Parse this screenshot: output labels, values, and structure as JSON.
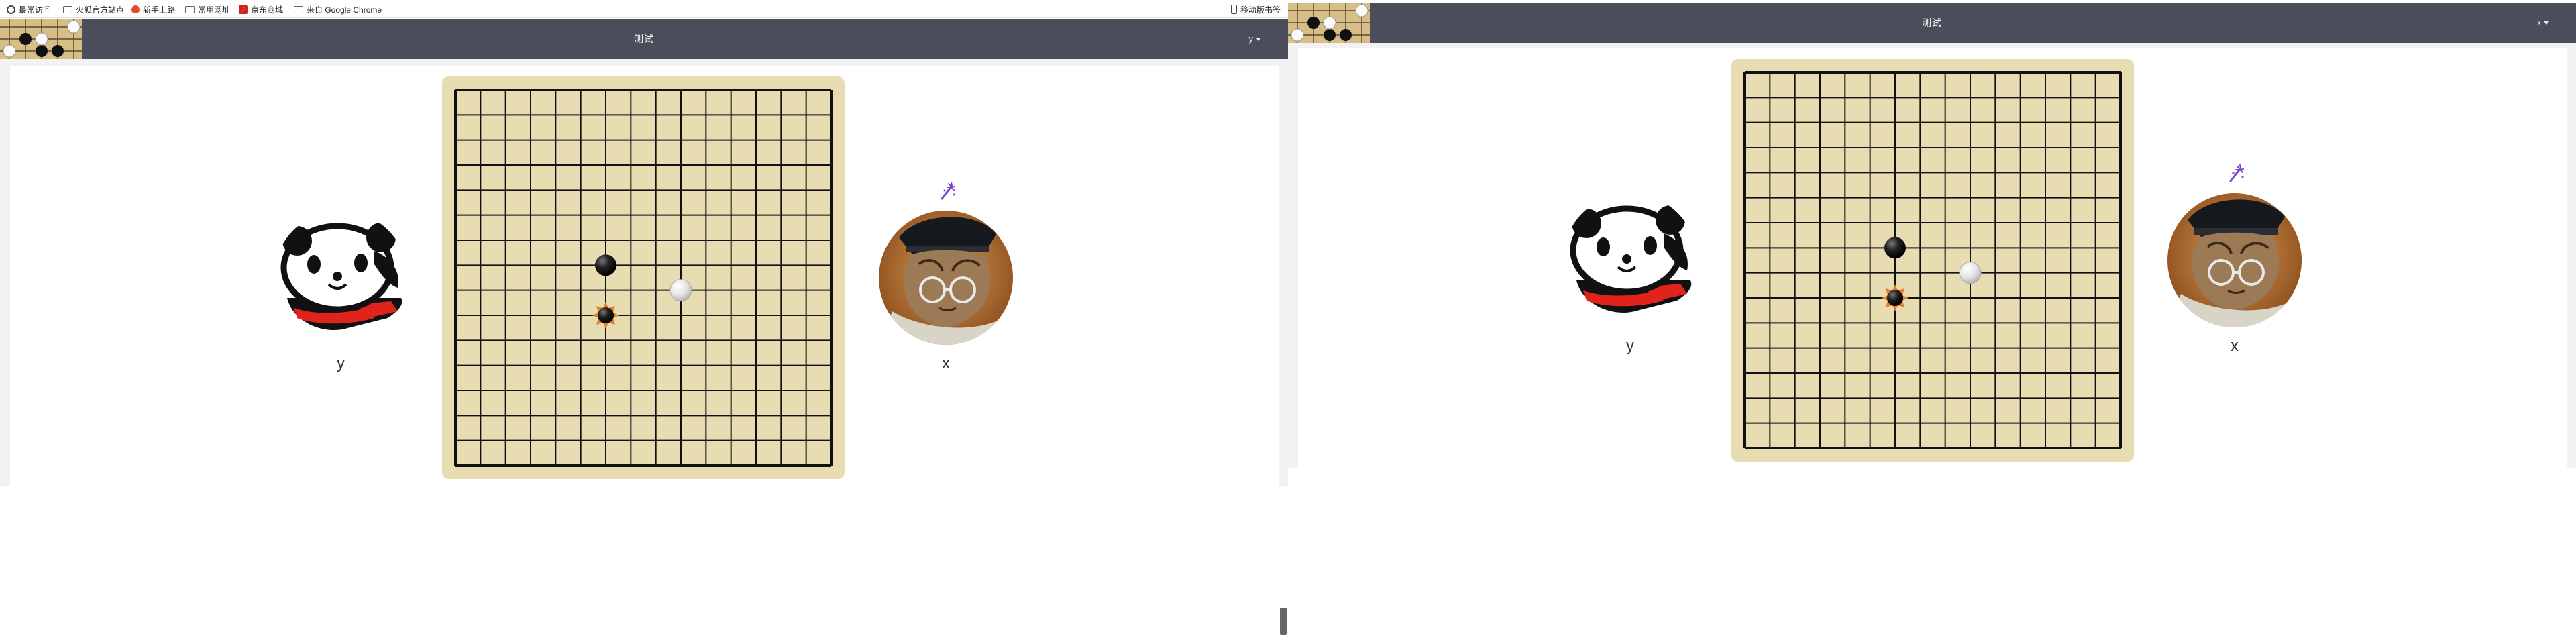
{
  "bookmarks": [
    {
      "icon": "gear-icon",
      "label": "最常访问"
    },
    {
      "icon": "folder-icon",
      "label": "火狐官方站点"
    },
    {
      "icon": "strawberry-icon",
      "label": "新手上路"
    },
    {
      "icon": "folder-icon",
      "label": "常用网址"
    },
    {
      "icon": "jd-icon",
      "label": "京东商城"
    },
    {
      "icon": "folder-icon",
      "label": "来自 Google Chrome"
    }
  ],
  "mobile_bookmarks": "移动版书签",
  "windows": [
    {
      "title": "测试",
      "current_user": "y",
      "players": {
        "left": {
          "name": "y",
          "avatar": "panda-avatar"
        },
        "right": {
          "name": "x",
          "avatar": "cat-avatar"
        }
      },
      "active_indicator": "magic-wand-icon",
      "board": {
        "size": 15,
        "stones": [
          {
            "color": "black",
            "col": 6,
            "row": 7
          },
          {
            "color": "white",
            "col": 9,
            "row": 8
          },
          {
            "color": "black",
            "col": 6,
            "row": 9,
            "last_move": true
          }
        ]
      }
    },
    {
      "title": "测试",
      "current_user": "x",
      "players": {
        "left": {
          "name": "y",
          "avatar": "panda-avatar"
        },
        "right": {
          "name": "x",
          "avatar": "cat-avatar"
        }
      },
      "active_indicator": "magic-wand-icon",
      "board": {
        "size": 15,
        "stones": [
          {
            "color": "black",
            "col": 6,
            "row": 7
          },
          {
            "color": "white",
            "col": 9,
            "row": 8
          },
          {
            "color": "black",
            "col": 6,
            "row": 9,
            "last_move": true
          }
        ]
      }
    }
  ],
  "colors": {
    "navbar": "#4b4e5a",
    "board": "#e8dcb3",
    "grid": "#111111",
    "last_move_marker": "#e67e22",
    "wand": "#7b3fd6"
  }
}
